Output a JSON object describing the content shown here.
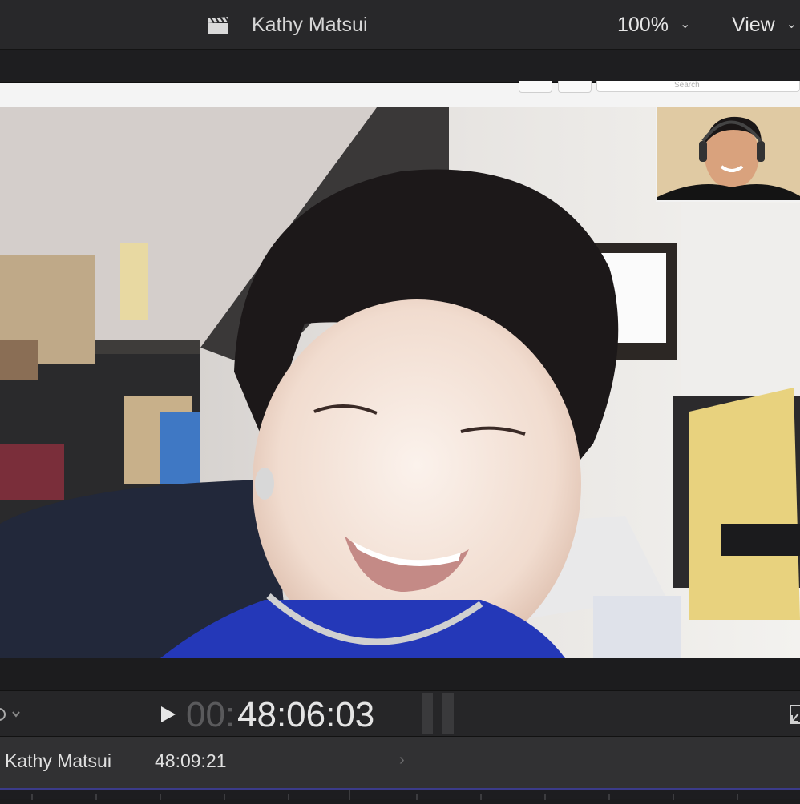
{
  "header": {
    "clip_title": "Kathy Matsui",
    "zoom_level": "100%",
    "view_menu": "View"
  },
  "app_toolbar": {
    "search_placeholder": "Search"
  },
  "transport": {
    "timecode_prefix": "00:",
    "timecode_main": "48:06:03"
  },
  "timeline": {
    "clip_name": "Kathy Matsui",
    "clip_time": "48:09:21"
  },
  "icons": {
    "clapper": "clapperboard-icon",
    "play": "play-icon",
    "pause": "pause-icon",
    "fullscreen": "fullscreen-icon",
    "settings": "gear-icon"
  }
}
